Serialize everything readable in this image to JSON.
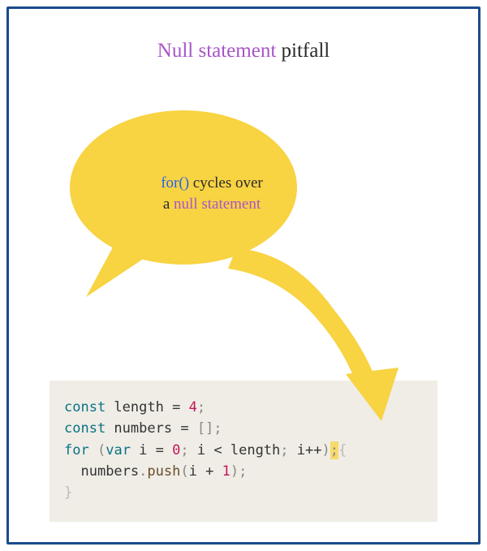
{
  "title": {
    "em": "Null statement",
    "plain": " pitfall"
  },
  "bubble": {
    "for": "for()",
    "text1": " cycles over",
    "text2": "a ",
    "null": "null statement"
  },
  "code": {
    "l1": {
      "kw": "const",
      "id": " length ",
      "eq": "=",
      "sp": " ",
      "num": "4",
      "semi": ";"
    },
    "l2": {
      "kw": "const",
      "id": " numbers ",
      "eq": "=",
      "sp": " ",
      "arr": "[]",
      "semi": ";"
    },
    "l3": {
      "kw": "for",
      "sp1": " ",
      "open": "(",
      "var": "var",
      "decl": " i ",
      "eq": "=",
      "sp2": " ",
      "zero": "0",
      "semi1": ";",
      "cond": " i ",
      "lt": "<",
      "cond2": " length",
      "semi2": ";",
      "inc": " i",
      "pp": "++",
      "close": ")",
      "hl": ";",
      "brace": "{"
    },
    "l4": {
      "indent": "  ",
      "obj": "numbers",
      "dot": ".",
      "method": "push",
      "open": "(",
      "arg": "i ",
      "plus": "+",
      "sp": " ",
      "one": "1",
      "close": ")",
      "semi": ";"
    },
    "l5": {
      "brace": "}"
    }
  }
}
